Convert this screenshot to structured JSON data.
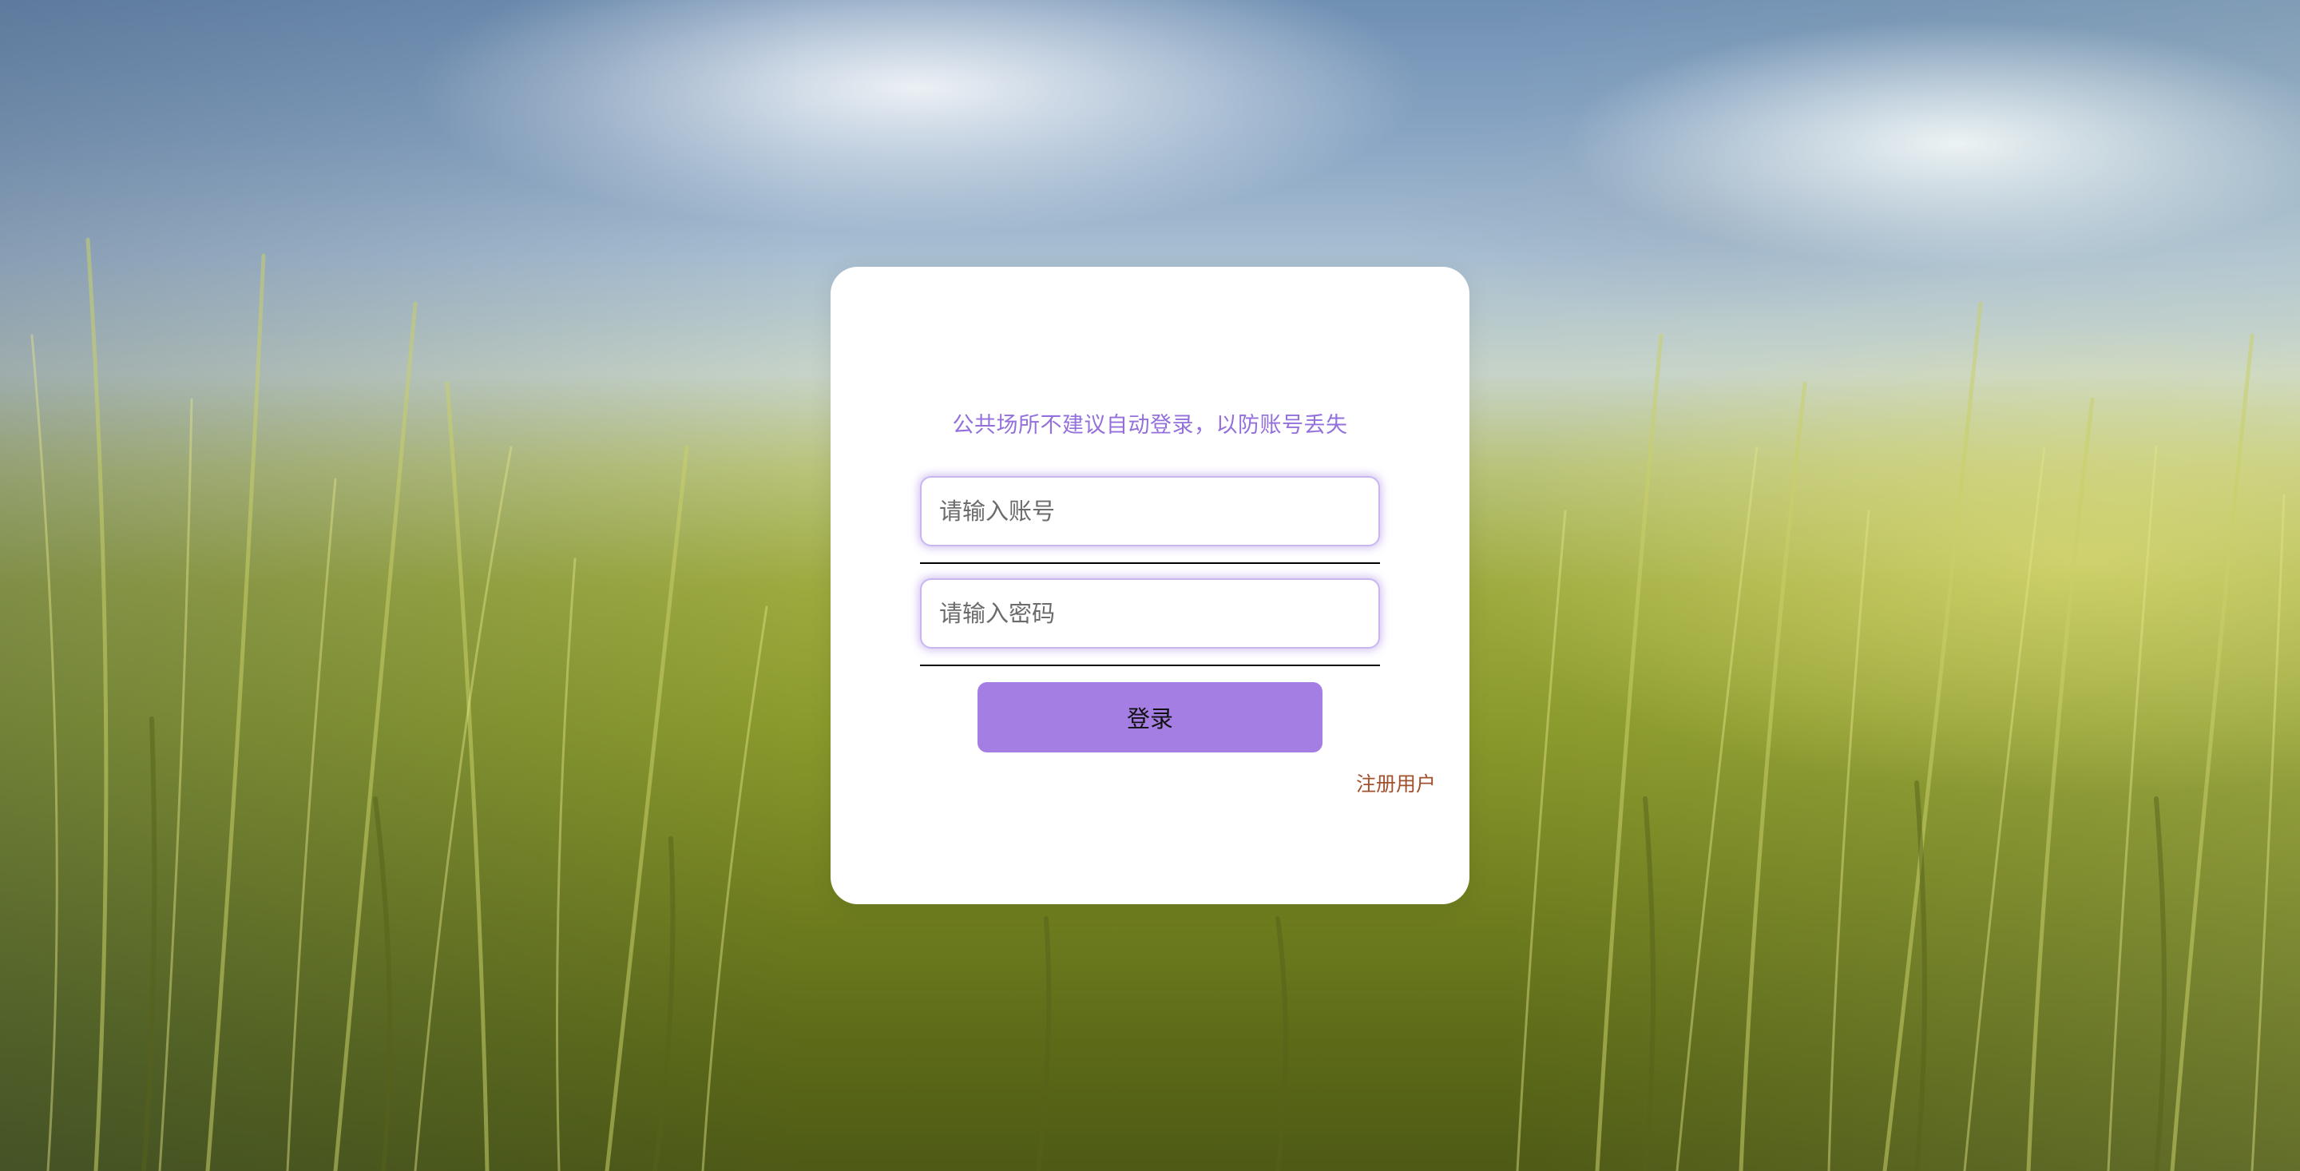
{
  "login": {
    "notice": "公共场所不建议自动登录，以防账号丢失",
    "username_placeholder": "请输入账号",
    "password_placeholder": "请输入密码",
    "submit_label": "登录",
    "register_label": "注册用户"
  },
  "colors": {
    "accent": "#a47ee2",
    "notice_text": "#9370db",
    "register_link": "#a0522d",
    "card_background": "#ffffff"
  }
}
